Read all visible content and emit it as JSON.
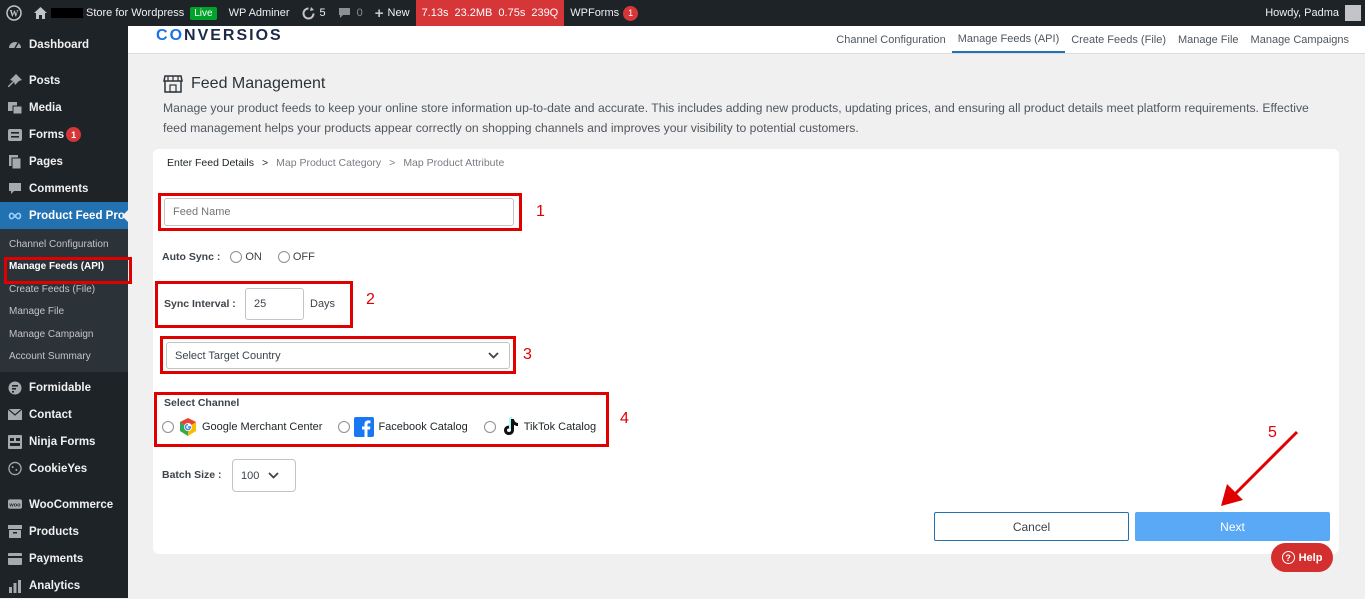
{
  "adminbar": {
    "site_name": "Store for Wordpress",
    "live_badge": "Live",
    "wp_adminer": "WP Adminer",
    "updates_count": "5",
    "comments_count": "0",
    "new_label": "New",
    "perf": {
      "time": "7.13s",
      "memory": "23.2MB",
      "query_time": "0.75s",
      "queries": "239Q"
    },
    "wpforms_label": "WPForms",
    "wpforms_count": "1",
    "howdy": "Howdy, Padma"
  },
  "sidebar": {
    "items_top": [
      {
        "label": "Dashboard",
        "icon": "dashboard-icon"
      },
      {
        "label": "Posts",
        "icon": "pin-icon"
      },
      {
        "label": "Media",
        "icon": "media-icon"
      },
      {
        "label": "Forms",
        "icon": "forms-icon",
        "badge": "1"
      },
      {
        "label": "Pages",
        "icon": "pages-icon"
      },
      {
        "label": "Comments",
        "icon": "comments-icon"
      },
      {
        "label": "Product Feed Pro",
        "icon": "infinity-icon"
      }
    ],
    "submenu": [
      {
        "label": "Channel Configuration"
      },
      {
        "label": "Manage Feeds (API)"
      },
      {
        "label": "Create Feeds (File)"
      },
      {
        "label": "Manage File"
      },
      {
        "label": "Manage Campaign"
      },
      {
        "label": "Account Summary"
      }
    ],
    "items_bottom": [
      {
        "label": "Formidable",
        "icon": "formidable-icon"
      },
      {
        "label": "Contact",
        "icon": "mail-icon"
      },
      {
        "label": "Ninja Forms",
        "icon": "ninja-icon"
      },
      {
        "label": "CookieYes",
        "icon": "cookie-icon"
      },
      {
        "label": "WooCommerce",
        "icon": "woo-icon"
      },
      {
        "label": "Products",
        "icon": "archive-icon"
      },
      {
        "label": "Payments",
        "icon": "payments-icon"
      },
      {
        "label": "Analytics",
        "icon": "analytics-icon"
      }
    ]
  },
  "topnav": {
    "logo_c": "C",
    "logo_o": "O",
    "logo_rest": "NVERSIOS",
    "tabs": [
      "Channel Configuration",
      "Manage Feeds (API)",
      "Create Feeds (File)",
      "Manage File",
      "Manage Campaigns"
    ]
  },
  "main": {
    "title": "Feed Management",
    "description": "Manage your product feeds to keep your online store information up-to-date and accurate. This includes adding new products, updating prices, and ensuring all product details meet platform requirements. Effective feed management helps your products appear correctly on shopping channels and improves your visibility to potential customers.",
    "breadcrumb": [
      "Enter Feed Details",
      ">",
      "Map Product Category",
      ">",
      "Map Product Attribute"
    ]
  },
  "form": {
    "feed_name_placeholder": "Feed Name",
    "auto_sync_label": "Auto Sync :",
    "auto_sync_on": "ON",
    "auto_sync_off": "OFF",
    "sync_interval_label": "Sync Interval :",
    "sync_interval_value": "25",
    "sync_interval_unit": "Days",
    "country_placeholder": "Select Target Country",
    "select_channel_label": "Select Channel",
    "channels": [
      "Google Merchant Center",
      "Facebook Catalog",
      "TikTok Catalog"
    ],
    "batch_size_label": "Batch Size :",
    "batch_size_value": "100",
    "cancel_label": "Cancel",
    "next_label": "Next",
    "help_label": "Help"
  },
  "annotations": [
    "1",
    "2",
    "3",
    "4",
    "5"
  ],
  "colors": {
    "accent": "#2271b1",
    "next_button": "#5aa9f7",
    "annotation": "#e00000",
    "help": "#d32f2f"
  }
}
